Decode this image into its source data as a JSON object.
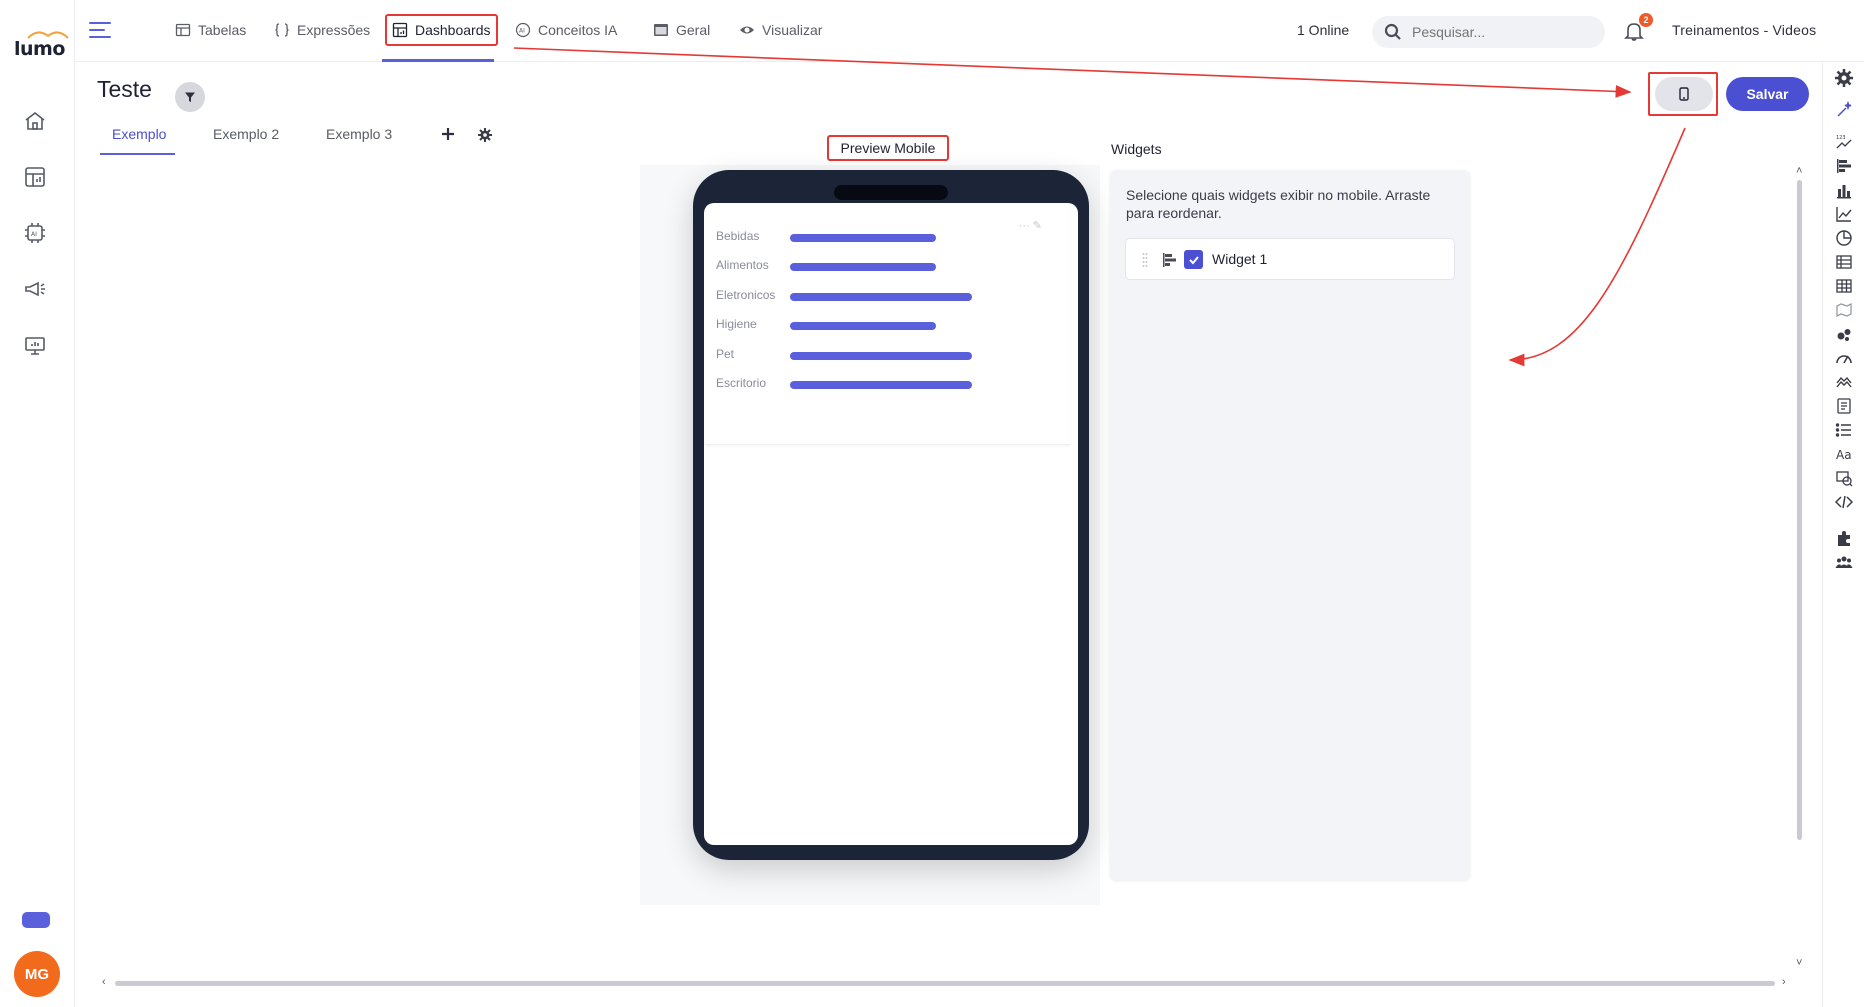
{
  "brand": {
    "logo_text": "lumo"
  },
  "nav": {
    "items": [
      {
        "label": "Tabelas"
      },
      {
        "label": "Expressões"
      },
      {
        "label": "Dashboards"
      },
      {
        "label": "Conceitos IA"
      },
      {
        "label": "Geral"
      },
      {
        "label": "Visualizar"
      }
    ]
  },
  "header": {
    "online": "1 Online",
    "search_placeholder": "Pesquisar...",
    "notifications": "2",
    "workspace": "Treinamentos - Videos"
  },
  "page": {
    "title": "Teste",
    "tabs": [
      {
        "label": "Exemplo"
      },
      {
        "label": "Exemplo 2"
      },
      {
        "label": "Exemplo 3"
      }
    ],
    "save_label": "Salvar"
  },
  "preview": {
    "label": "Preview Mobile",
    "widget_tools": "···  ✎"
  },
  "chart_data": {
    "type": "bar",
    "categories": [
      "Bebidas",
      "Alimentos",
      "Eletronicos",
      "Higiene",
      "Pet",
      "Escritorio"
    ],
    "values": [
      0.8,
      0.8,
      1.0,
      0.8,
      1.0,
      1.0
    ],
    "xlabel": "",
    "ylabel": ""
  },
  "widgets_panel": {
    "title": "Widgets",
    "hint": "Selecione quais widgets exibir no mobile. Arraste para reordenar.",
    "items": [
      {
        "name": "Widget 1",
        "checked": true
      }
    ]
  },
  "user": {
    "initials": "MG"
  },
  "colors": {
    "accent": "#5a5fdc",
    "save": "#4b4fd1",
    "annotation": "#e53935",
    "phone": "#1c2437",
    "avatar": "#f26a1b"
  }
}
